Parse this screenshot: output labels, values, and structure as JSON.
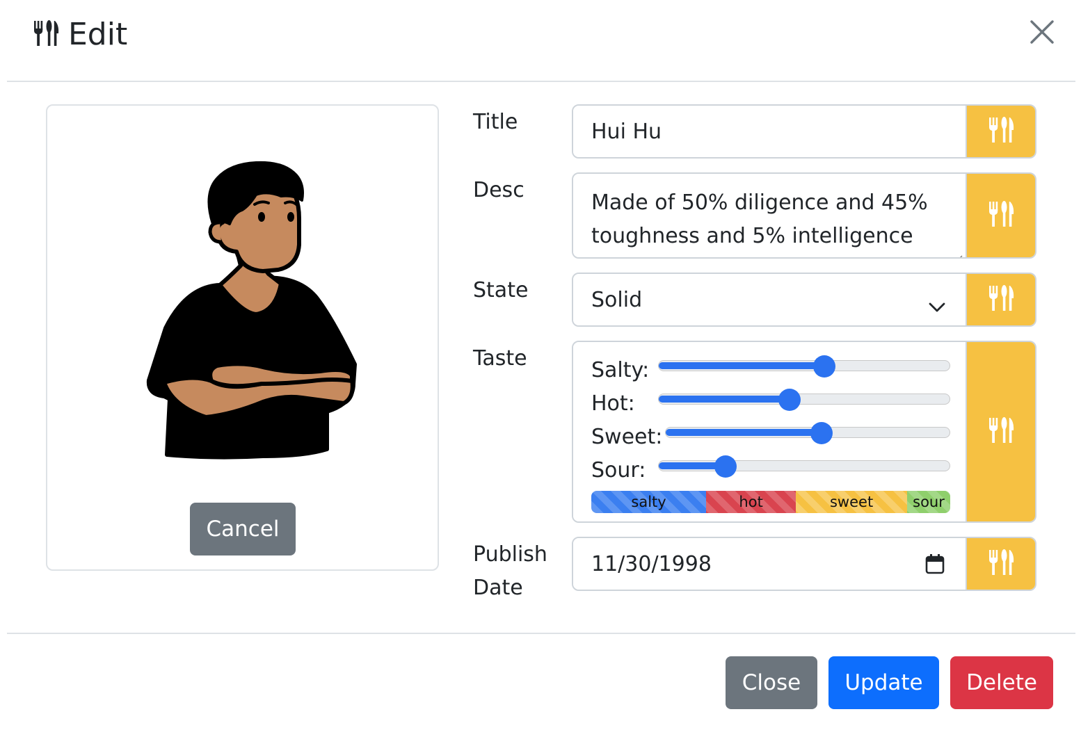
{
  "header": {
    "title": "Edit",
    "icon": "utensils-icon"
  },
  "image_card": {
    "cancel_label": "Cancel"
  },
  "form": {
    "title": {
      "label": "Title",
      "value": "Hui Hu"
    },
    "desc": {
      "label": "Desc",
      "value": "Made of 50% diligence and 45% toughness and 5% intelligence"
    },
    "state": {
      "label": "State",
      "value": "Solid"
    },
    "taste": {
      "label": "Taste",
      "sliders": [
        {
          "label": "Salty:",
          "percent": 57
        },
        {
          "label": "Hot:",
          "percent": 45
        },
        {
          "label": "Sweet:",
          "percent": 55
        },
        {
          "label": "Sour:",
          "percent": 23
        }
      ],
      "bar": [
        {
          "label": "salty",
          "percent": 32
        },
        {
          "label": "hot",
          "percent": 25
        },
        {
          "label": "sweet",
          "percent": 31
        },
        {
          "label": "sour",
          "percent": 12
        }
      ]
    },
    "publish_date": {
      "label_line1": "Publish",
      "label_line2": "Date",
      "value": "11/30/1998"
    }
  },
  "footer": {
    "close_label": "Close",
    "update_label": "Update",
    "delete_label": "Delete"
  },
  "colors": {
    "addon": "#f6c142",
    "primary": "#0d6efd",
    "secondary": "#6c757d",
    "danger": "#dc3545"
  }
}
